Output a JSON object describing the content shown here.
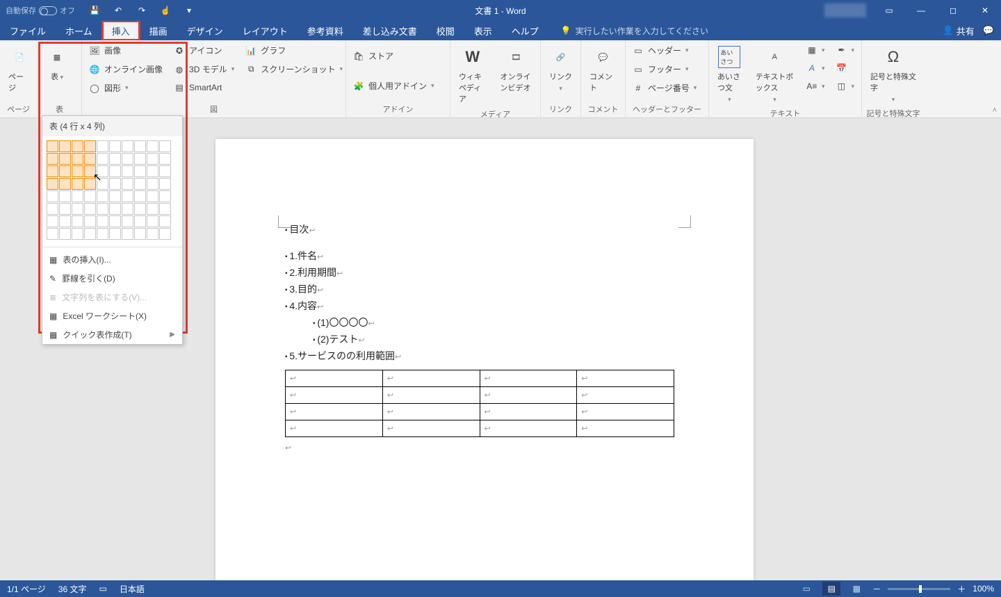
{
  "titlebar": {
    "auto_save": "自動保存",
    "auto_save_state": "オフ",
    "title": "文書 1  -  Word"
  },
  "tabs": {
    "file": "ファイル",
    "home": "ホーム",
    "insert": "挿入",
    "draw": "描画",
    "design": "デザイン",
    "layout": "レイアウト",
    "references": "参考資料",
    "mailings": "差し込み文書",
    "review": "校閲",
    "view": "表示",
    "help": "ヘルプ",
    "tell_me": "実行したい作業を入力してください",
    "share": "共有"
  },
  "ribbon": {
    "pages": {
      "label": "ページ",
      "cover": "ページ"
    },
    "tables": {
      "label": "表",
      "big": "表"
    },
    "illustrations": {
      "label": "図",
      "pictures": "画像",
      "online_pictures": "オンライン画像",
      "shapes": "図形",
      "icons": "アイコン",
      "models3d": "3D モデル",
      "smartart": "SmartArt",
      "chart": "グラフ",
      "screenshot": "スクリーンショット"
    },
    "addins": {
      "label": "アドイン",
      "store": "ストア",
      "my": "個人用アドイン"
    },
    "media": {
      "label": "メディア",
      "wiki": "ウィキペディア",
      "video": "オンラインビデオ"
    },
    "links": {
      "label": "リンク",
      "link": "リンク"
    },
    "comments": {
      "label": "コメント",
      "comment": "コメント"
    },
    "headerfooter": {
      "label": "ヘッダーとフッター",
      "header": "ヘッダー",
      "footer": "フッター",
      "page_number": "ページ番号"
    },
    "text": {
      "label": "テキスト",
      "greeting": "あいさつ文",
      "textbox": "テキストボックス"
    },
    "symbols": {
      "label": "記号と特殊文字",
      "symbol": "記号と特殊文字"
    }
  },
  "table_dropdown": {
    "title": "表 (4 行 x 4 列)",
    "insert_table": "表の挿入(I)...",
    "draw_table": "罫線を引く(D)",
    "text_to_table": "文字列を表にする(V)...",
    "excel": "Excel ワークシート(X)",
    "quick_tables": "クイック表作成(T)",
    "sel_rows": 4,
    "sel_cols": 4
  },
  "document": {
    "lines": [
      "目次",
      "1.件名",
      "2.利用期間",
      "3.目的",
      "4.内容",
      "(1)〇〇〇〇",
      "(2)テスト",
      "5.サービスのの利用範囲"
    ]
  },
  "statusbar": {
    "page": "1/1 ページ",
    "words": "36 文字",
    "lang": "日本語",
    "zoom": "100%"
  }
}
